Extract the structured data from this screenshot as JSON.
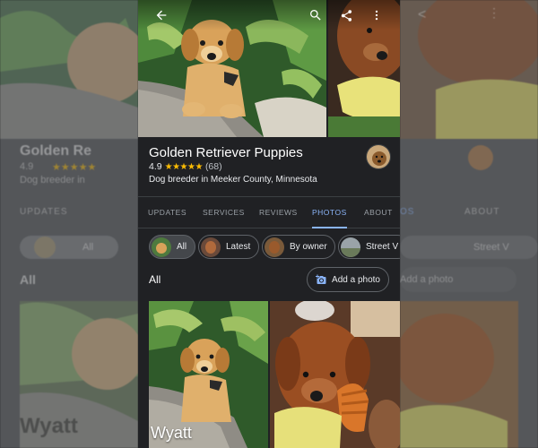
{
  "place": {
    "title": "Golden Retriever Puppies",
    "rating": "4.9",
    "stars": "★★★★★",
    "review_count": "(68)",
    "category": "Dog breeder in Meeker County, Minnesota"
  },
  "topbar": {
    "back_icon": "arrow-back-icon",
    "search_icon": "search-icon",
    "share_icon": "share-icon",
    "menu_icon": "more-vert-icon"
  },
  "tabs": [
    {
      "label": "UPDATES",
      "active": false
    },
    {
      "label": "SERVICES",
      "active": false
    },
    {
      "label": "REVIEWS",
      "active": false
    },
    {
      "label": "PHOTOS",
      "active": true
    },
    {
      "label": "ABOUT",
      "active": false
    }
  ],
  "chips": [
    {
      "label": "All",
      "selected": true
    },
    {
      "label": "Latest",
      "selected": false
    },
    {
      "label": "By owner",
      "selected": false
    },
    {
      "label": "Street V",
      "selected": false
    }
  ],
  "section": {
    "title": "All",
    "add_photo_label": "Add a photo"
  },
  "photos": [
    {
      "caption": "Wyatt"
    },
    {
      "caption": ""
    }
  ],
  "ghost_left": {
    "title": "Golden Re",
    "rating": "4.9",
    "category": "Dog breeder in",
    "tab": "UPDATES",
    "chip": "All",
    "section": "All",
    "caption": "Wyatt"
  },
  "ghost_right": {
    "tab_partial": "OS",
    "tab": "ABOUT",
    "chip": "Street V",
    "add_photo": "Add a photo"
  },
  "colors": {
    "background": "#202124",
    "accent": "#8ab4f8",
    "star": "#fbbc04"
  }
}
